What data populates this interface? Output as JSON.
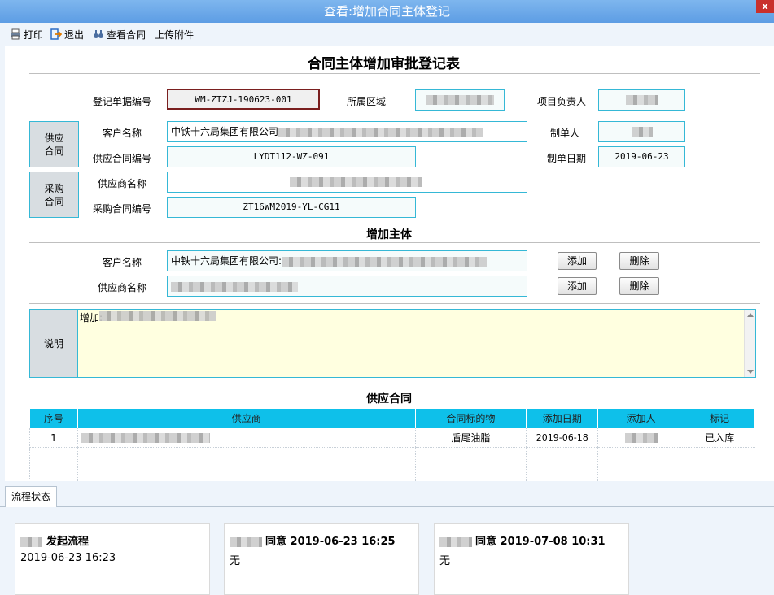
{
  "window": {
    "title": "查看:增加合同主体登记",
    "close_label": "x"
  },
  "toolbar": {
    "print": "打印",
    "exit": "退出",
    "view_contract": "查看合同",
    "upload": "上传附件"
  },
  "form": {
    "title": "合同主体增加审批登记表",
    "doc_no_label": "登记单据编号",
    "doc_no": "WM-ZTZJ-190623-001",
    "region_label": "所属区域",
    "pm_label": "项目负责人",
    "supply_side": "供应\n合同",
    "purchase_side": "采购\n合同",
    "customer_label": "客户名称",
    "customer_value": "中铁十六局集团有限公司",
    "maker_label": "制单人",
    "supply_no_label": "供应合同编号",
    "supply_no": "LYDT112-WZ-091",
    "date_label": "制单日期",
    "date_value": "2019-06-23",
    "supplier_label": "供应商名称",
    "purchase_no_label": "采购合同编号",
    "purchase_no": "ZT16WM2019-YL-CG11"
  },
  "add_subject": {
    "title": "增加主体",
    "customer_label": "客户名称",
    "customer_value": "中铁十六局集团有限公司:",
    "supplier_label": "供应商名称",
    "add_btn": "添加",
    "delete_btn": "删除"
  },
  "note": {
    "label": "说明",
    "value": "增加:"
  },
  "supply_contract": {
    "title": "供应合同",
    "columns": [
      "序号",
      "供应商",
      "合同标的物",
      "添加日期",
      "添加人",
      "标记"
    ],
    "rows": [
      {
        "no": "1",
        "item": "盾尾油脂",
        "date": "2019-06-18",
        "mark": "已入库"
      }
    ]
  },
  "flow": {
    "tab": "流程状态",
    "cards": [
      {
        "who": "发起流程",
        "text": "2019-06-23 16:23"
      },
      {
        "who": "同意 2019-06-23 16:25",
        "text": "无"
      },
      {
        "who": "同意 2019-07-08 10:31",
        "text": "无"
      }
    ]
  },
  "colors": {
    "accent": "#35b8d6",
    "table_header": "#0ec0ea",
    "note_bg": "#ffffe0"
  }
}
